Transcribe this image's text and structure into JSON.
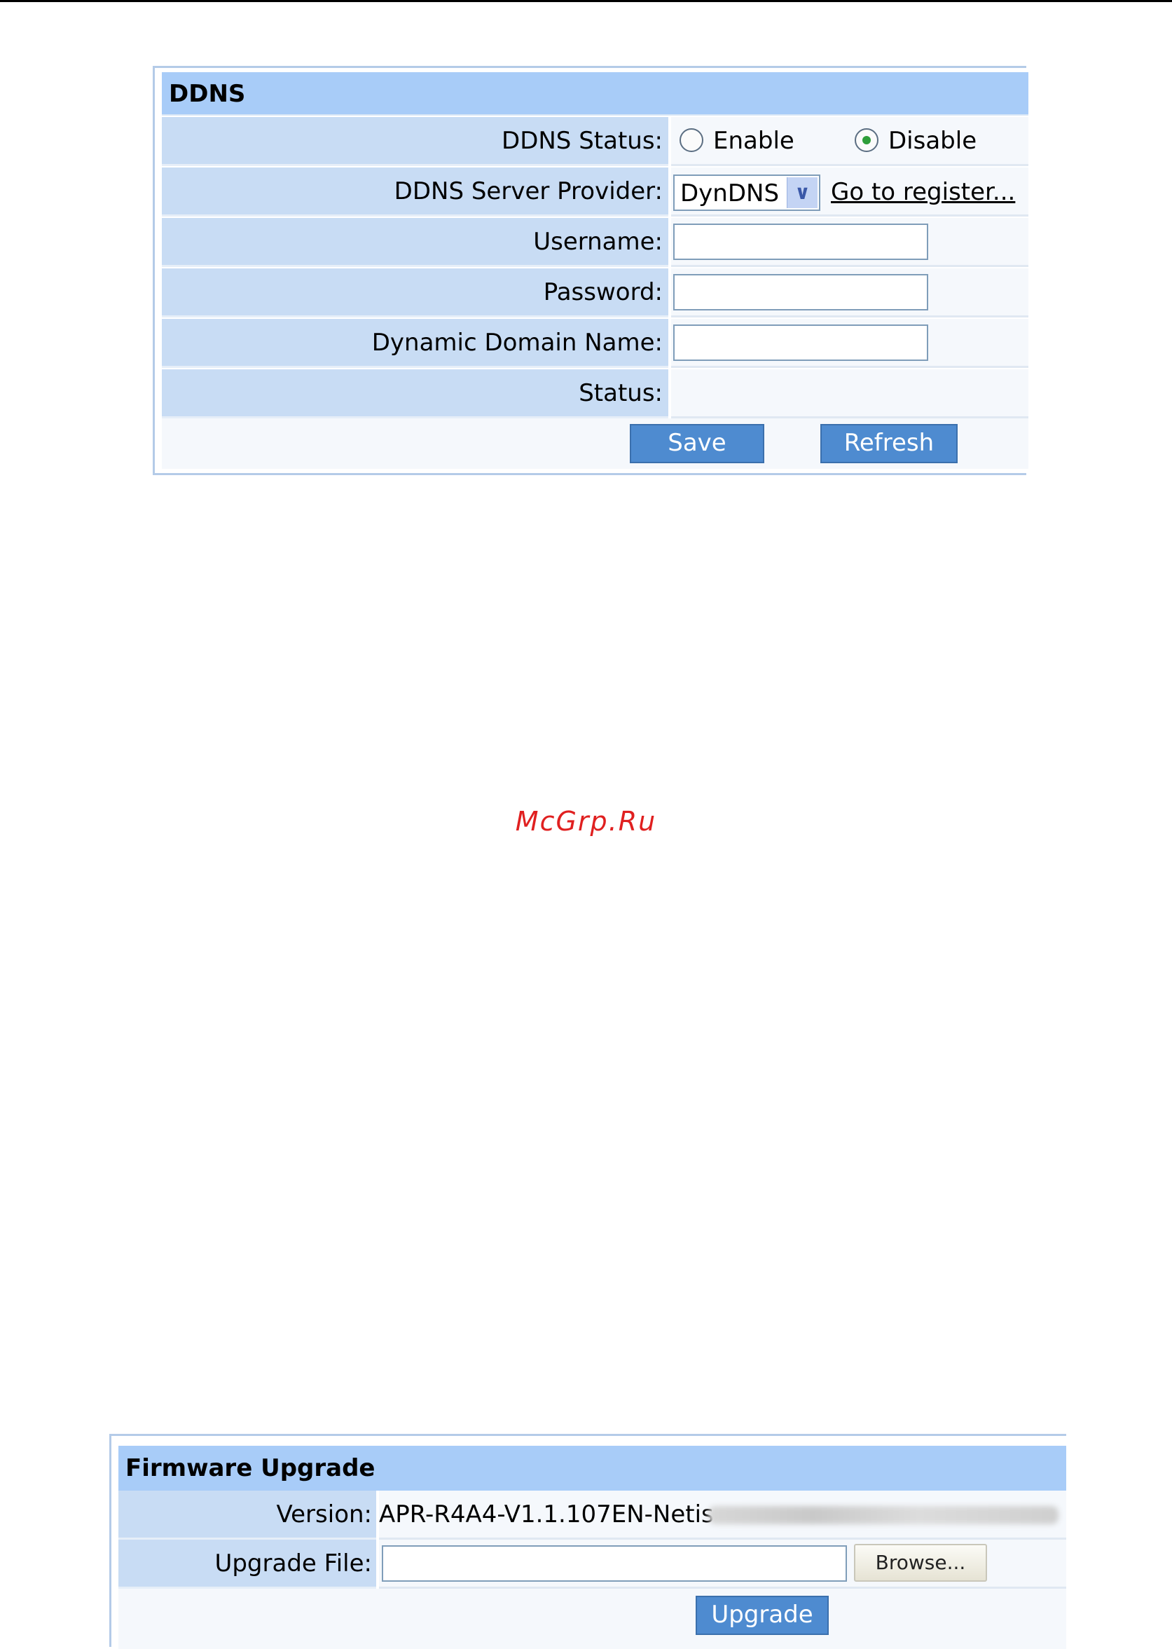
{
  "ddns": {
    "title": "DDNS",
    "status_label": "DDNS Status:",
    "enable_label": "Enable",
    "disable_label": "Disable",
    "selected_status": "Disable",
    "provider_label": "DDNS Server Provider:",
    "provider_value": "DynDNS",
    "register_link": "Go to register...",
    "username_label": "Username:",
    "username_value": "",
    "password_label": "Password:",
    "password_value": "",
    "domain_label": "Dynamic Domain Name:",
    "domain_value": "",
    "status_text_label": "Status:",
    "status_text_value": "",
    "save_button": "Save",
    "refresh_button": "Refresh"
  },
  "watermark": "McGrp.Ru",
  "firmware": {
    "title": "Firmware Upgrade",
    "version_label": "Version:",
    "version_value": "APR-R4A4-V1.1.107EN-Netis",
    "upgrade_file_label": "Upgrade File:",
    "upgrade_file_value": "",
    "browse_button": "Browse...",
    "upgrade_button": "Upgrade"
  },
  "colors": {
    "header_bg": "#a8ccf8",
    "label_bg": "#c8dcf4",
    "button_bg": "#4e8bd0",
    "watermark": "#e02020"
  }
}
